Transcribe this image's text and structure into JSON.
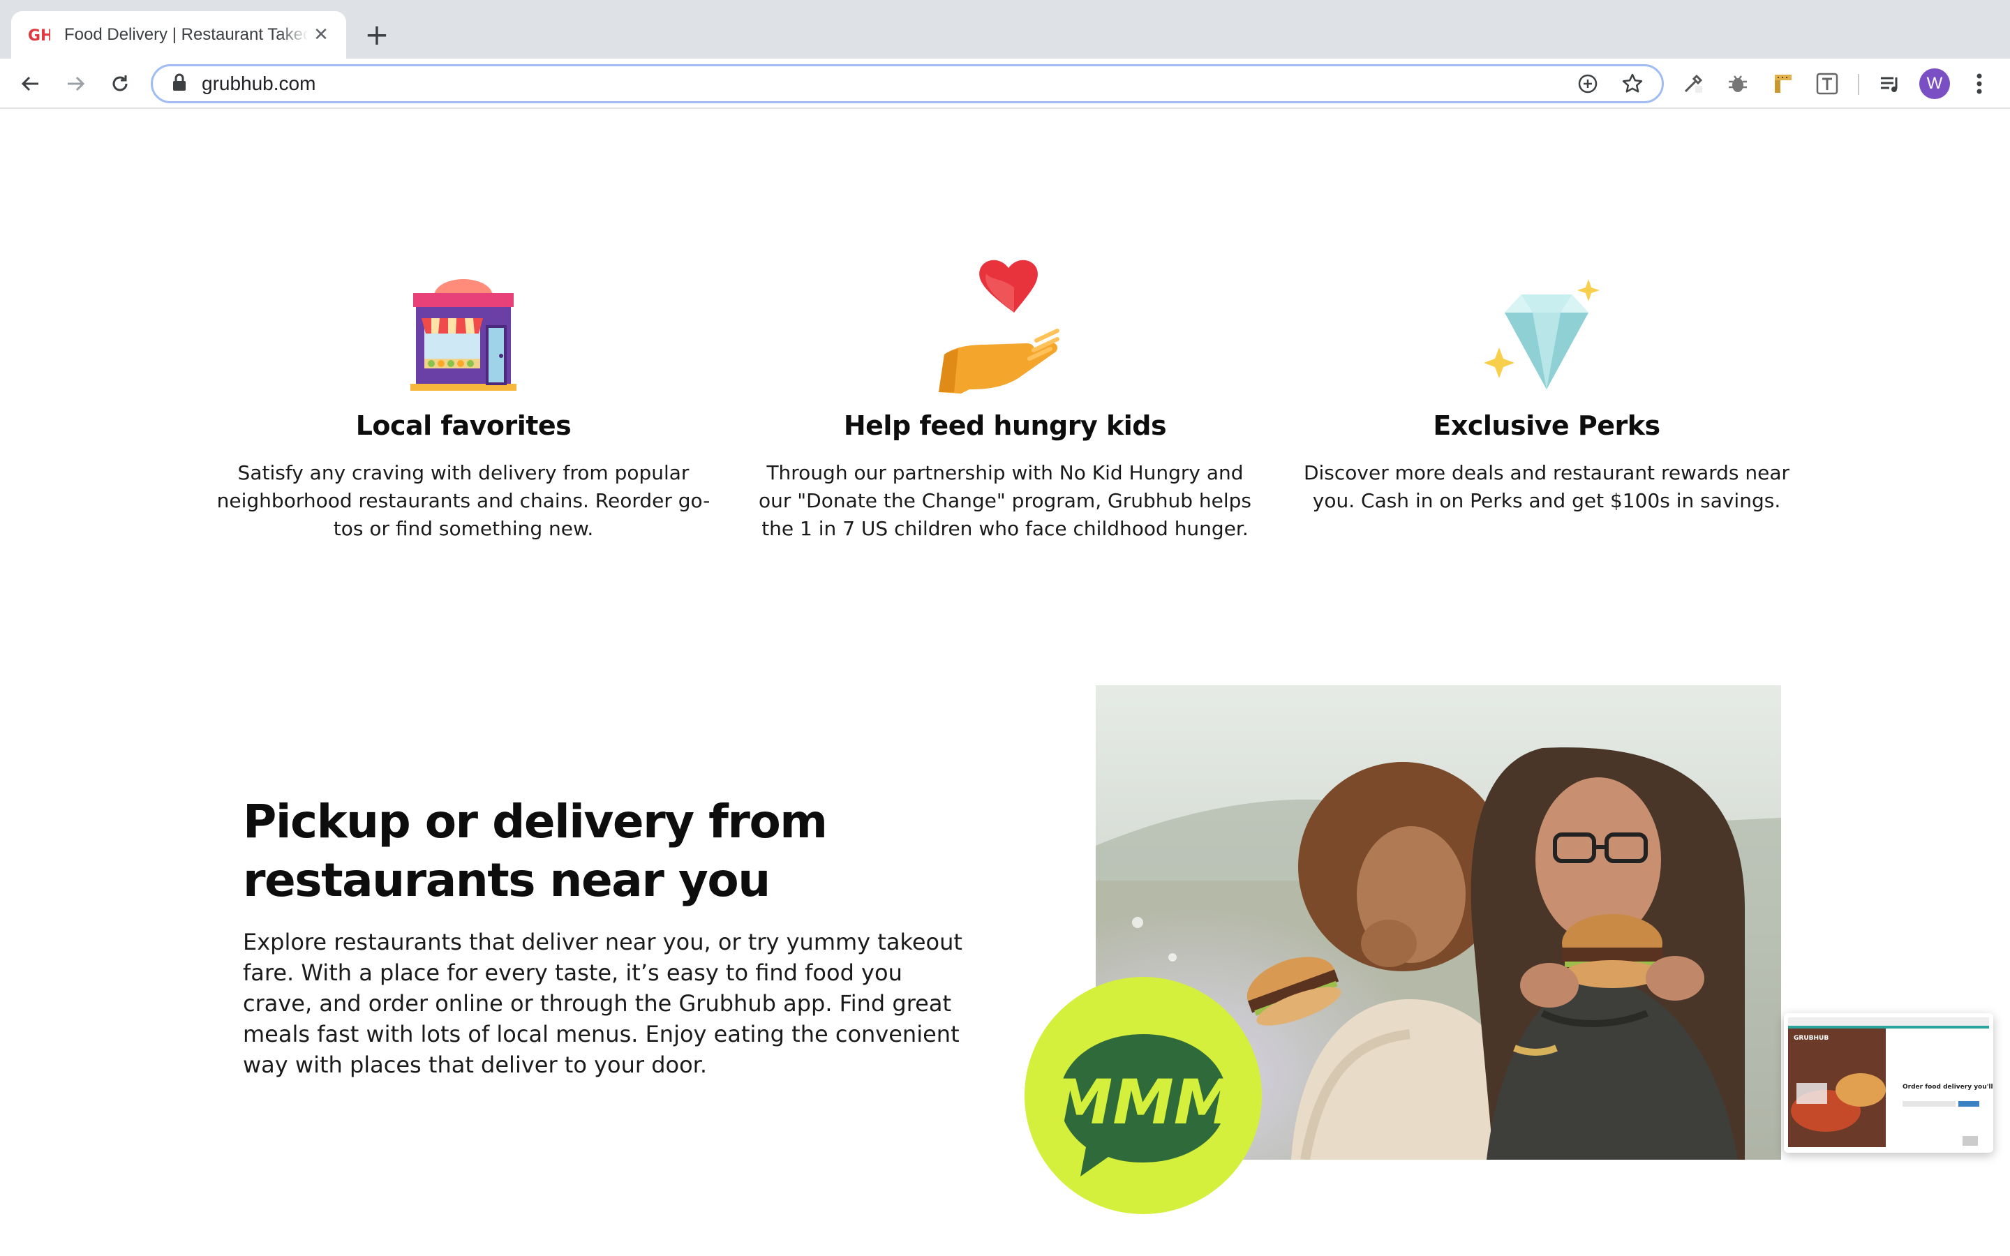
{
  "browser": {
    "tab_title": "Food Delivery | Restaurant Takeout",
    "favicon_text": "GH",
    "url": "grubhub.com",
    "profile_initial": "W"
  },
  "features": [
    {
      "title": "Local favorites",
      "description": "Satisfy any craving with delivery from popular neighborhood restaurants and chains. Reorder go-tos or find something new."
    },
    {
      "title": "Help feed hungry kids",
      "description": "Through our partnership with No Kid Hungry and our \"Donate the Change\" program, Grubhub helps the 1 in 7 US children who face childhood hunger."
    },
    {
      "title": "Exclusive Perks",
      "description": "Discover more deals and restaurant rewards near you. Cash in on Perks and get $100s in savings."
    }
  ],
  "promo": {
    "heading": "Pickup or delivery from restaurants near you",
    "body": "Explore restaurants that deliver near you, or try yummy takeout fare. With a place for every taste, it’s easy to find food you crave, and order online or through the Grubhub app. Find great meals fast with lots of local menus. Enjoy eating the convenient way with places that deliver to your door.",
    "badge_text": "MMM"
  },
  "thumbnail": {
    "brand": "GRUBHUB",
    "headline": "Order food delivery you'll love"
  },
  "colors": {
    "badge_green": "#d4ef3c",
    "badge_text": "#2f6b3a",
    "heart_red": "#e8323c",
    "hand_orange": "#f4a52c",
    "omnibox_border": "#9fbcf5",
    "avatar_purple": "#7b4fc4"
  }
}
